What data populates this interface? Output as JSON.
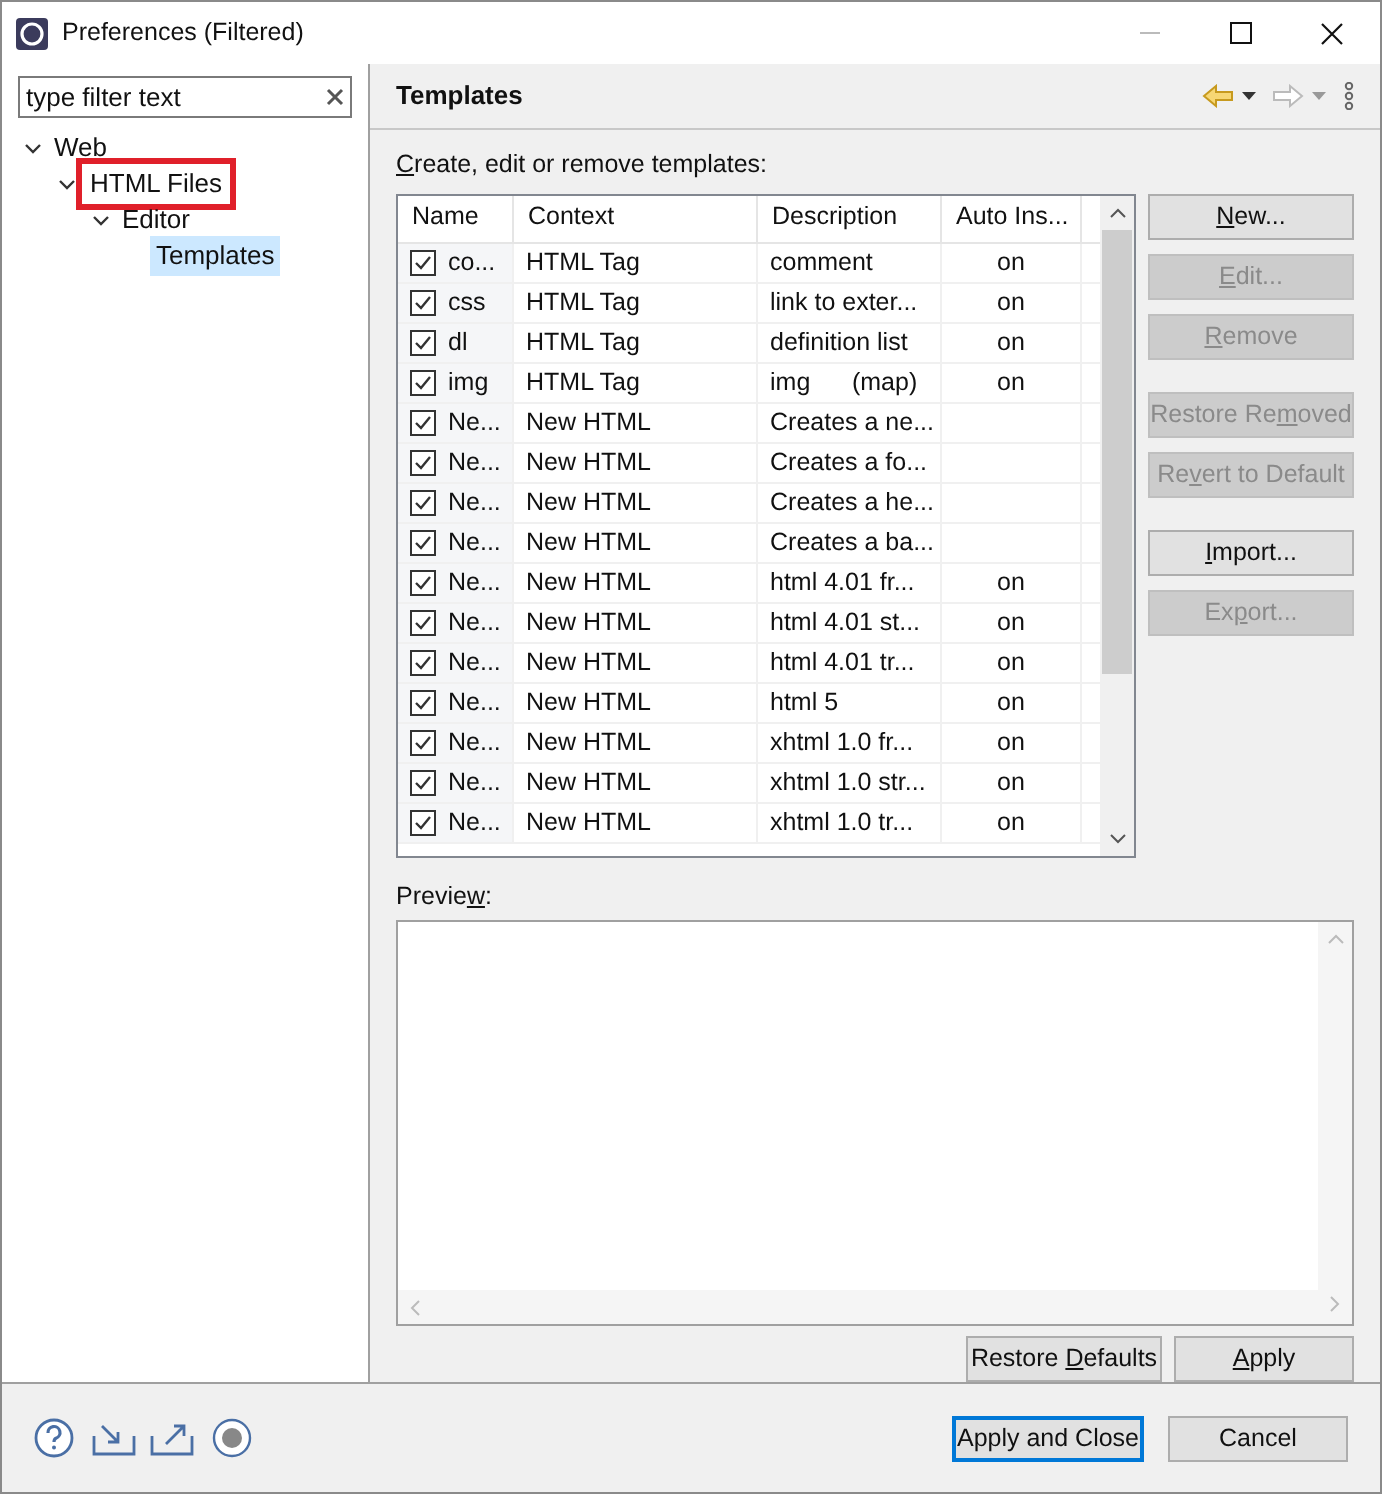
{
  "window": {
    "title": "Preferences (Filtered)"
  },
  "sidebar": {
    "filter": {
      "value": "type filter text"
    },
    "tree": [
      {
        "label": "Web",
        "expanded": true,
        "selected": false,
        "highlighted": false,
        "children": [
          {
            "label": "HTML Files",
            "expanded": true,
            "selected": false,
            "highlighted": true,
            "children": [
              {
                "label": "Editor",
                "expanded": true,
                "selected": false,
                "highlighted": false,
                "children": [
                  {
                    "label": "Templates",
                    "selected": true,
                    "highlighted": false
                  }
                ]
              }
            ]
          }
        ]
      }
    ]
  },
  "page": {
    "title": "Templates",
    "intro": {
      "key": "C",
      "after": "reate, edit or remove templates:"
    },
    "table": {
      "columns": [
        "Name",
        "Context",
        "Description",
        "Auto Ins..."
      ],
      "rows": [
        {
          "checked": true,
          "cells": [
            "co...",
            "HTML Tag",
            "comment",
            "on"
          ]
        },
        {
          "checked": true,
          "cells": [
            "css",
            "HTML Tag",
            "link to exter...",
            "on"
          ]
        },
        {
          "checked": true,
          "cells": [
            "dl",
            "HTML Tag",
            "definition list",
            "on"
          ]
        },
        {
          "checked": true,
          "cells": [
            "img",
            "HTML Tag",
            "img      (map)",
            "on"
          ]
        },
        {
          "checked": true,
          "cells": [
            "Ne...",
            "New HTML",
            "Creates a ne...",
            ""
          ]
        },
        {
          "checked": true,
          "cells": [
            "Ne...",
            "New HTML",
            "Creates a fo...",
            ""
          ]
        },
        {
          "checked": true,
          "cells": [
            "Ne...",
            "New HTML",
            "Creates a he...",
            ""
          ]
        },
        {
          "checked": true,
          "cells": [
            "Ne...",
            "New HTML",
            "Creates a ba...",
            ""
          ]
        },
        {
          "checked": true,
          "cells": [
            "Ne...",
            "New HTML",
            "html 4.01 fr...",
            "on"
          ]
        },
        {
          "checked": true,
          "cells": [
            "Ne...",
            "New HTML",
            "html 4.01 st...",
            "on"
          ]
        },
        {
          "checked": true,
          "cells": [
            "Ne...",
            "New HTML",
            "html 4.01 tr...",
            "on"
          ]
        },
        {
          "checked": true,
          "cells": [
            "Ne...",
            "New HTML",
            "html 5",
            "on"
          ]
        },
        {
          "checked": true,
          "cells": [
            "Ne...",
            "New HTML",
            "xhtml 1.0 fr...",
            "on"
          ]
        },
        {
          "checked": true,
          "cells": [
            "Ne...",
            "New HTML",
            "xhtml 1.0 str...",
            "on"
          ]
        },
        {
          "checked": true,
          "cells": [
            "Ne...",
            "New HTML",
            "xhtml 1.0 tr...",
            "on"
          ]
        }
      ]
    },
    "button_groups": [
      [
        {
          "label": {
            "key": "N",
            "after": "ew..."
          },
          "disabled": false
        },
        {
          "label": {
            "key": "E",
            "after": "dit..."
          },
          "disabled": true
        },
        {
          "label": {
            "key": "R",
            "after": "emove"
          },
          "disabled": true
        }
      ],
      [
        {
          "label": {
            "before": "Restore Re",
            "key": "m",
            "after": "oved"
          },
          "disabled": true
        },
        {
          "label": {
            "before": "Re",
            "key": "v",
            "after": "ert to Default"
          },
          "disabled": true
        }
      ],
      [
        {
          "label": {
            "key": "I",
            "after": "mport..."
          },
          "disabled": false
        },
        {
          "label": {
            "before": "Ex",
            "key": "p",
            "after": "ort..."
          },
          "disabled": true
        }
      ]
    ],
    "preview_label": {
      "before": "Previe",
      "key": "w",
      "after": ":"
    },
    "footer_buttons": [
      {
        "label": {
          "before": "Restore ",
          "key": "D",
          "after": "efaults"
        }
      },
      {
        "label": {
          "key": "A",
          "after": "pply"
        }
      }
    ]
  },
  "dialog_buttons": [
    {
      "label": "Apply and Close",
      "default": true
    },
    {
      "label": "Cancel",
      "default": false
    }
  ]
}
